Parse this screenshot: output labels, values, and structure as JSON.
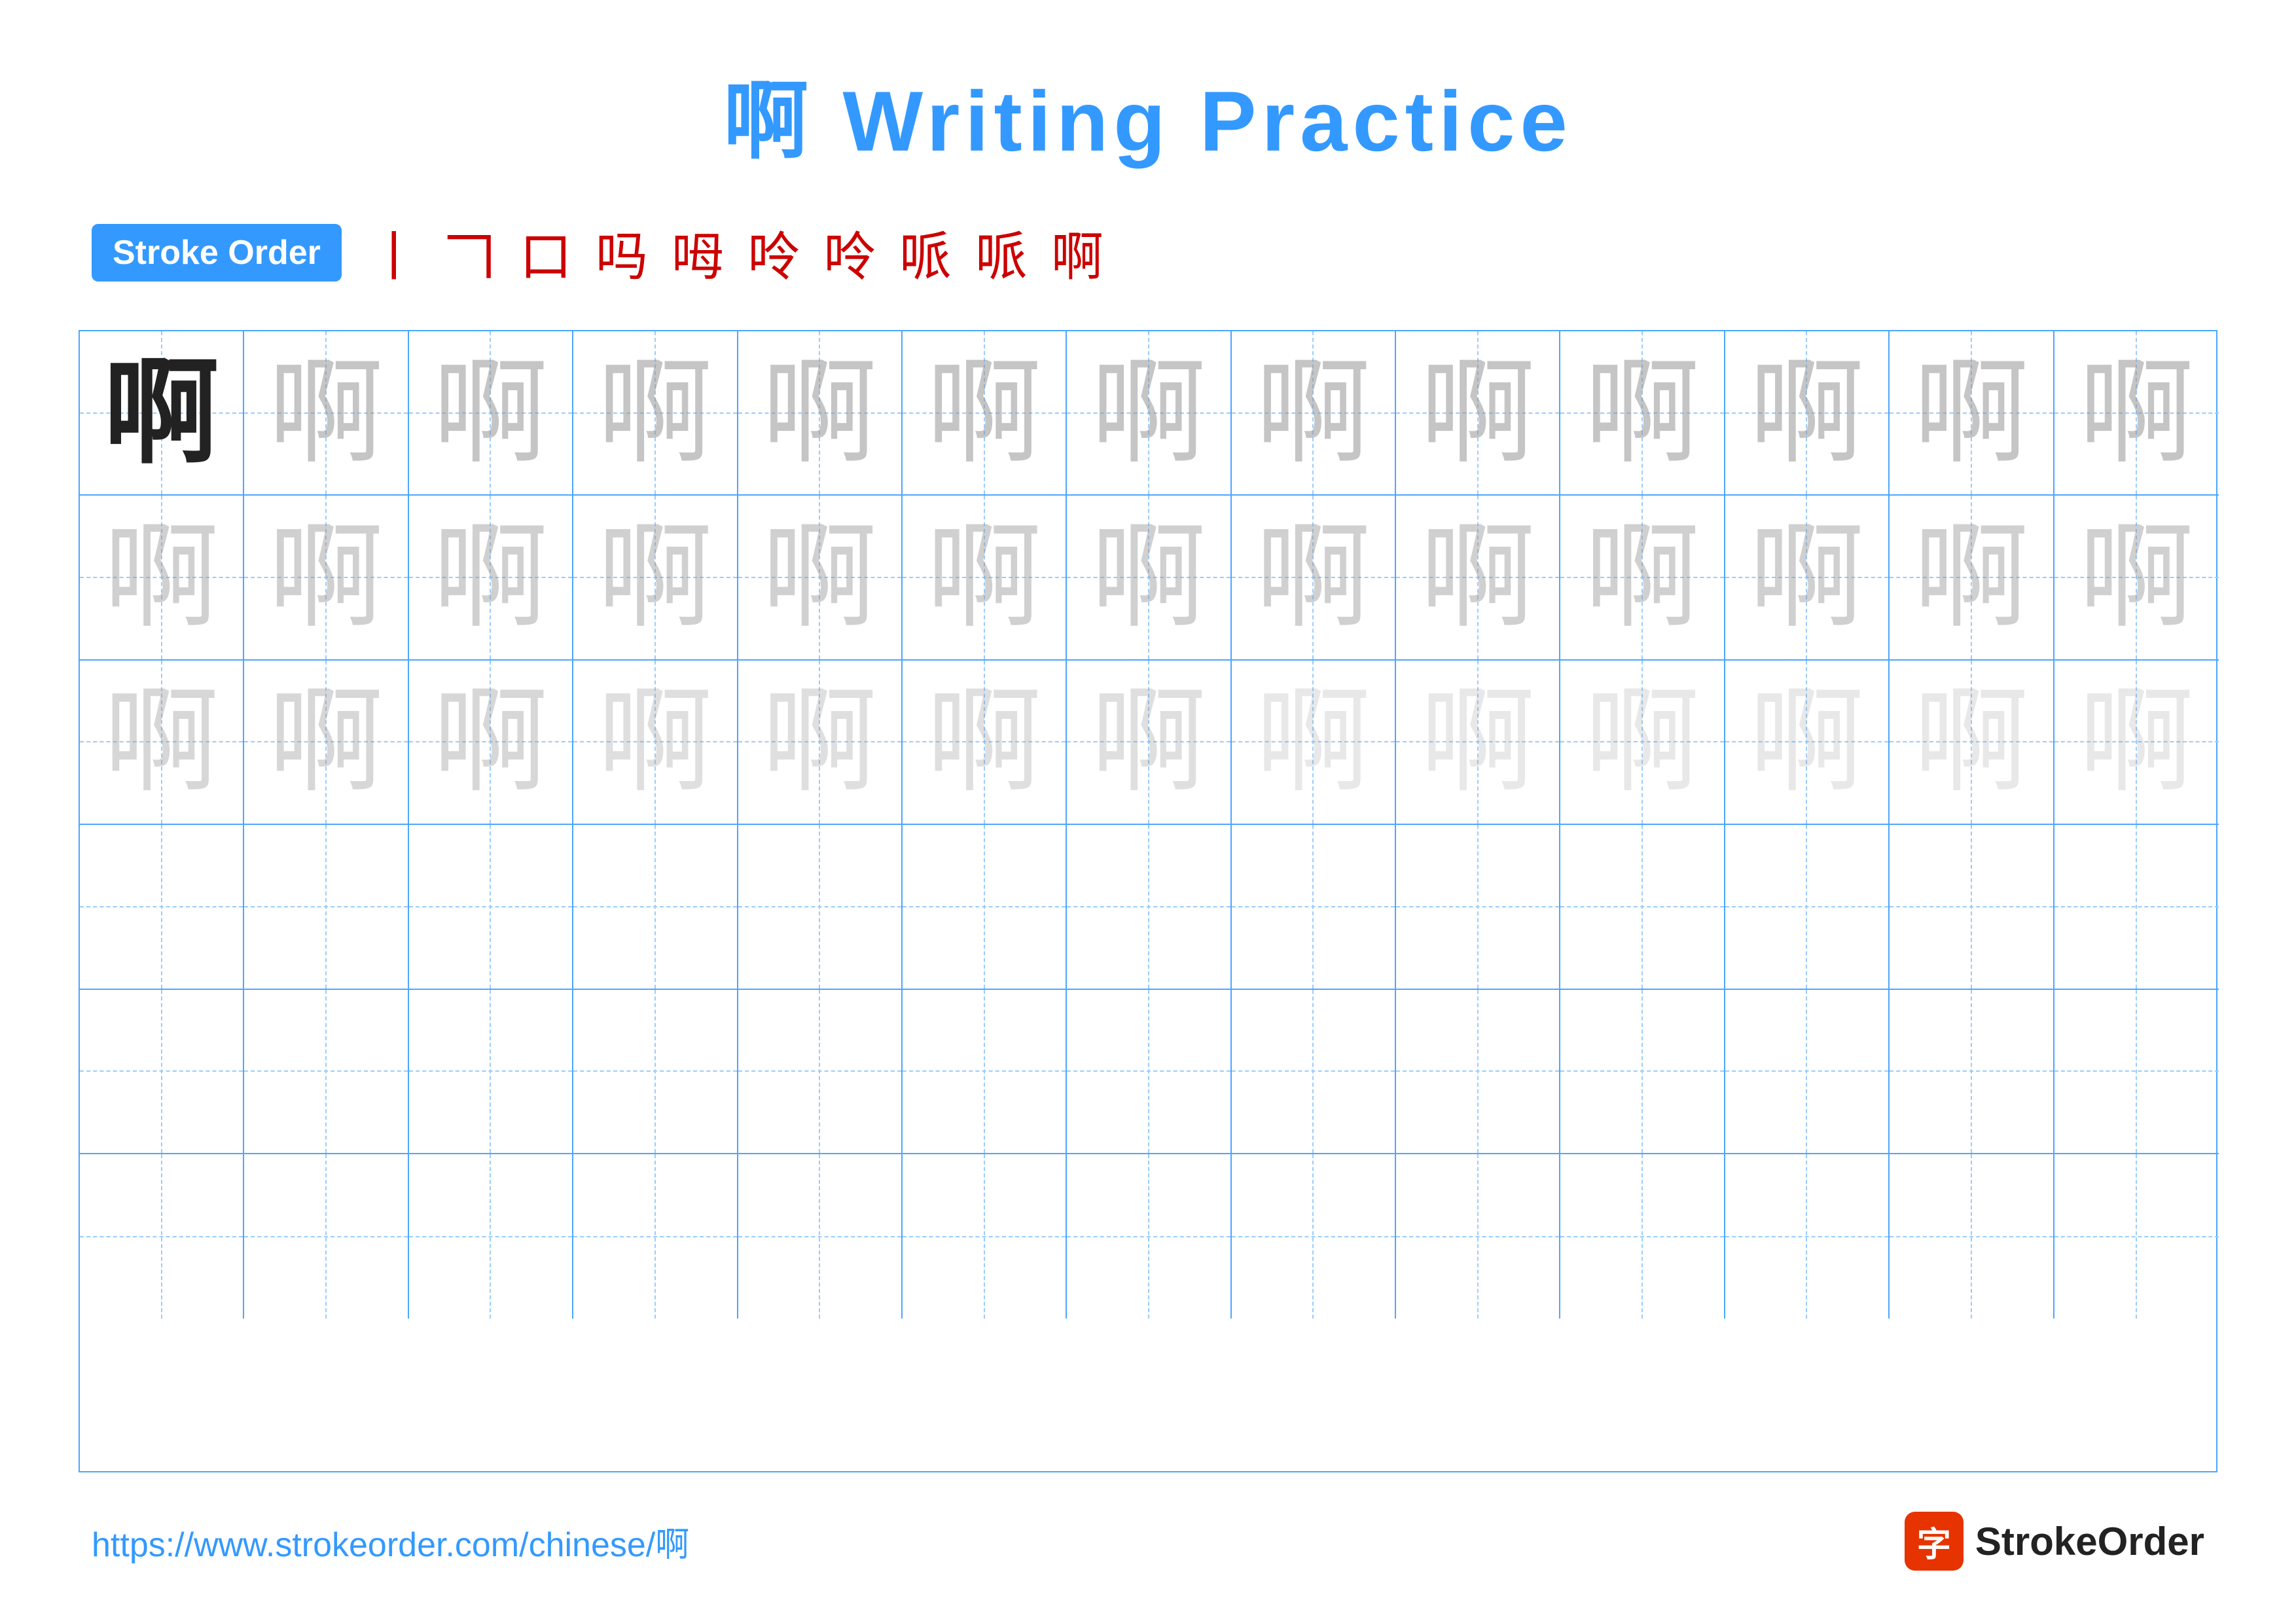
{
  "title": {
    "character": "啊",
    "text": "Writing Practice",
    "full": "啊 Writing Practice"
  },
  "stroke_order": {
    "badge_label": "Stroke Order",
    "strokes": [
      "丨",
      "𠃍",
      "口",
      "吗",
      "吗",
      "呶",
      "呶",
      "呷",
      "呸",
      "啊"
    ]
  },
  "grid": {
    "rows": 6,
    "cols": 13,
    "character": "啊",
    "filled_rows": 3,
    "fade_levels": [
      "char-fade-1",
      "char-fade-2",
      "char-fade-3",
      "char-fade-4",
      "char-fade-5"
    ]
  },
  "footer": {
    "url": "https://www.strokeorder.com/chinese/啊",
    "brand": "StrokeOrder"
  }
}
